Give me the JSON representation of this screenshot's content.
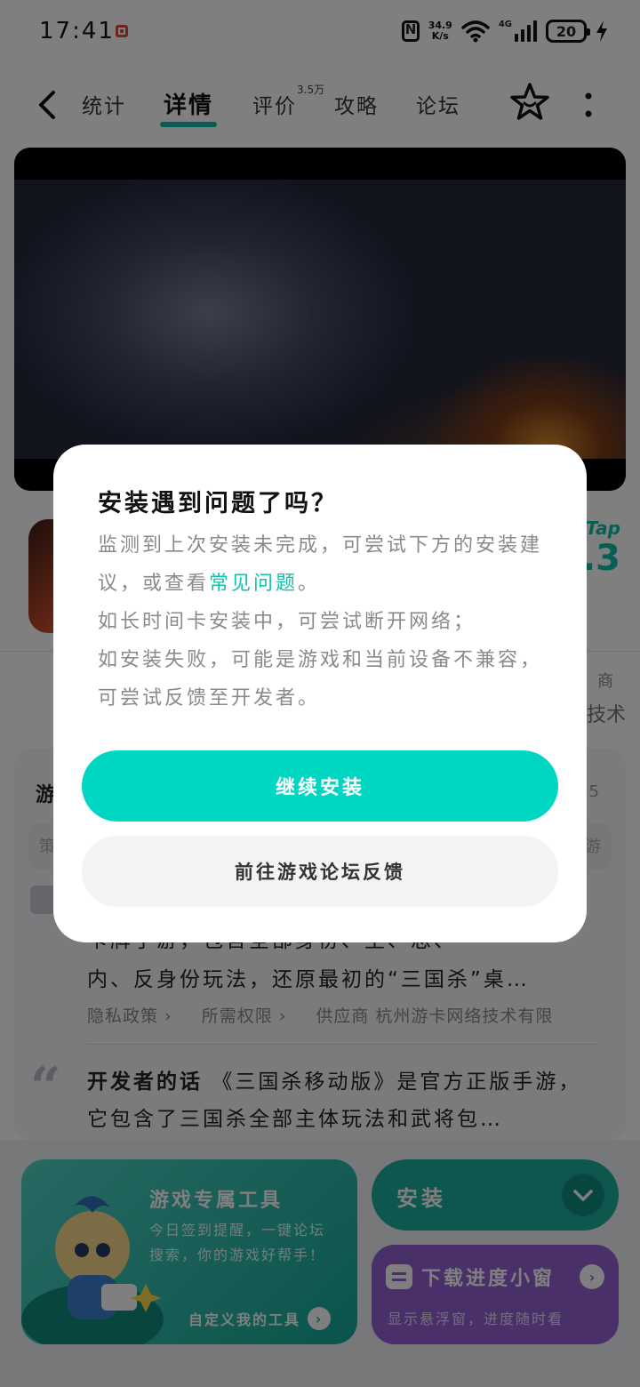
{
  "status_bar": {
    "time": "17:41",
    "net_speed_value": "34.9",
    "net_speed_unit": "K/s",
    "signal_label": "4G",
    "battery": "20"
  },
  "nav": {
    "tabs": [
      {
        "label": "统计"
      },
      {
        "label": "详情"
      },
      {
        "label": "评价"
      },
      {
        "label": "攻略"
      },
      {
        "label": "论坛"
      }
    ],
    "active_tab": "详情",
    "review_score": "3.5万"
  },
  "rating": {
    "label": "Tap",
    "score": ".3"
  },
  "side_fragments": {
    "a": "商",
    "b": "技术"
  },
  "card": {
    "title_fragment": "游",
    "badge_fragment": "5",
    "tag_left": "策",
    "tag_right": "游",
    "description_line1": "卡牌手游，包含全部身份、主、忠、",
    "description_line2": "内、反身份玩法，还原最初的“三国杀”桌…",
    "links": [
      "隐私政策 ›",
      "所需权限 ›",
      "供应商 杭州游卡网络技术有限"
    ],
    "dev_words_label": "开发者的话",
    "dev_words_text": "《三国杀移动版》是官方正版手游，它包含了三国杀全部主体玩法和武将包…"
  },
  "bottom": {
    "tools_title": "游戏专属工具",
    "tools_desc": "今日签到提醒，一键论坛搜索，你的游戏好帮手！",
    "tools_link": "自定义我的工具",
    "install_label": "安装",
    "progress_title": "下载进度小窗",
    "progress_desc": "显示悬浮窗，进度随时看"
  },
  "dialog": {
    "title": "安装遇到问题了吗？",
    "body_part1": "监测到上次安装未完成，可尝试下方的安装建议，或查看",
    "faq_link": "常见问题",
    "body_part2": "。",
    "body_line_network": "如长时间卡安装中，可尝试断开网络；",
    "body_line_fail": "如安装失败，可能是游戏和当前设备不兼容，可尝试反馈至开发者。",
    "continue_button": "继续安装",
    "feedback_button": "前往游戏论坛反馈"
  },
  "colors": {
    "accent": "#00d7c3",
    "accent_dark": "#1aae9c",
    "progress_purple": "#9561d0"
  }
}
